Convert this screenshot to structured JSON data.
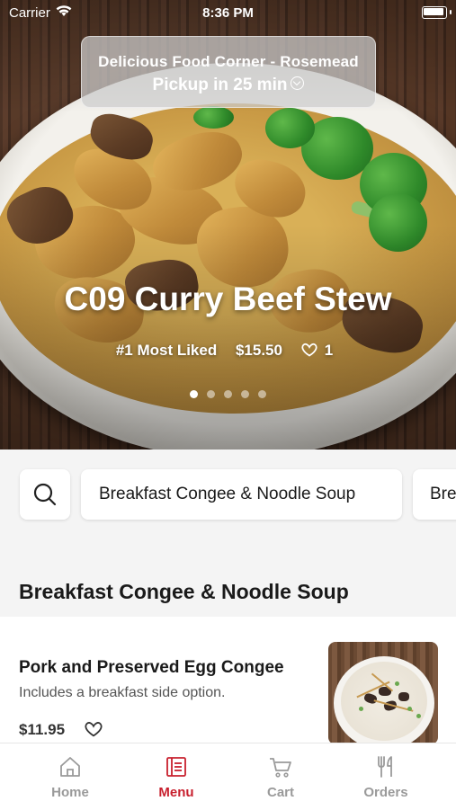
{
  "status_bar": {
    "carrier": "Carrier",
    "time": "8:36 PM"
  },
  "pickup": {
    "store": "Delicious Food Corner - Rosemead",
    "eta": "Pickup in 25 min"
  },
  "featured": {
    "title": "C09 Curry Beef Stew",
    "badge": "#1 Most Liked",
    "price": "$15.50",
    "likes": "1",
    "page_count": 5,
    "active_page": 1
  },
  "categories": {
    "search_icon": "search-icon",
    "chips": [
      "Breakfast Congee & Noodle Soup",
      "Bre"
    ]
  },
  "section": {
    "title": "Breakfast Congee & Noodle Soup"
  },
  "items": [
    {
      "name": "Pork and Preserved Egg Congee",
      "description": "Includes a breakfast side option.",
      "price": "$11.95"
    }
  ],
  "tabs": [
    {
      "label": "Home",
      "icon": "home-icon",
      "active": false
    },
    {
      "label": "Menu",
      "icon": "menu-icon",
      "active": true
    },
    {
      "label": "Cart",
      "icon": "cart-icon",
      "active": false
    },
    {
      "label": "Orders",
      "icon": "fork-knife-icon",
      "active": false
    }
  ],
  "colors": {
    "accent": "#c8202e",
    "tab_inactive": "#9a9a9a"
  }
}
